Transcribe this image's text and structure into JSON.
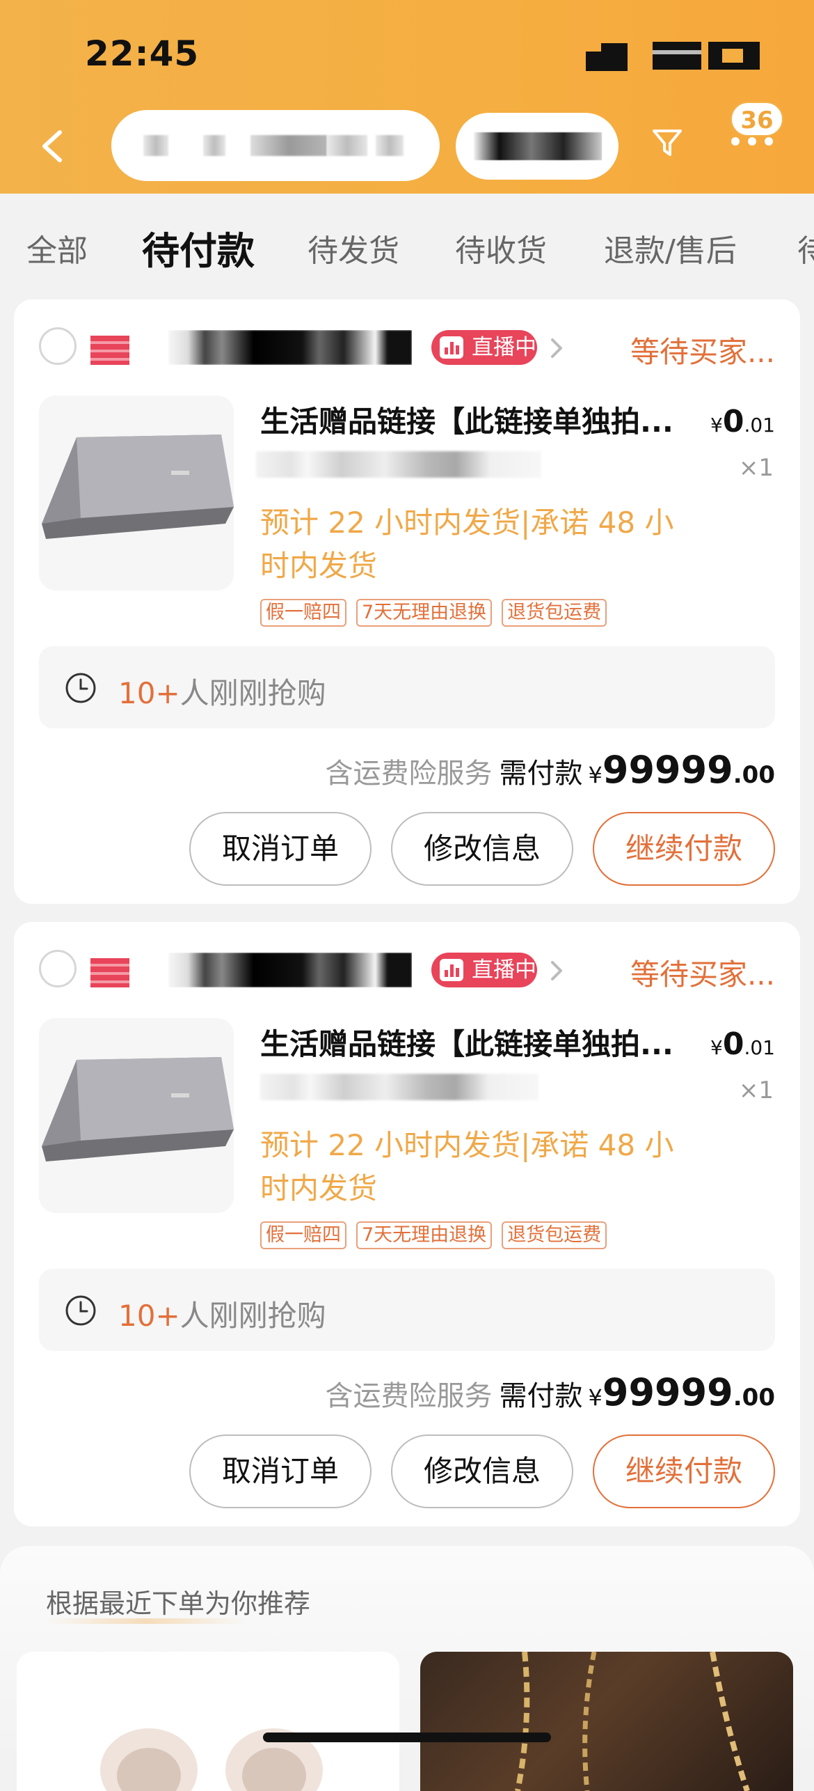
{
  "status_bar": {
    "time": "22:45"
  },
  "header": {
    "message_count": "36",
    "icons": {
      "back": "chevron-left-icon",
      "filter": "funnel-icon",
      "more": "more-dots-icon"
    }
  },
  "tabs": [
    {
      "label": "全部",
      "active": false
    },
    {
      "label": "待付款",
      "active": true
    },
    {
      "label": "待发货",
      "active": false
    },
    {
      "label": "待收货",
      "active": false
    },
    {
      "label": "退款/售后",
      "active": false
    },
    {
      "label": "待",
      "active": false
    }
  ],
  "orders": [
    {
      "live_label": "直播中",
      "status": "等待买家...",
      "product_title": "生活赠品链接【此链接单独拍...",
      "price_currency": "¥",
      "price_int": "0",
      "price_dec": ".01",
      "quantity": "×1",
      "shipping_line1": "预计 22 小时内发货|承诺 48 小",
      "shipping_line2": "时内发货",
      "tags": [
        "假一赔四",
        "7天无理由退换",
        "退货包运费"
      ],
      "rush_count": "10+",
      "rush_text": "人刚刚抢购",
      "service_text": "含运费险服务",
      "need_pay_label": "需付款",
      "total_currency": "¥",
      "total_int": "99999",
      "total_dec": ".00",
      "buttons": {
        "cancel": "取消订单",
        "modify": "修改信息",
        "pay": "继续付款"
      }
    },
    {
      "live_label": "直播中",
      "status": "等待买家...",
      "product_title": "生活赠品链接【此链接单独拍...",
      "price_currency": "¥",
      "price_int": "0",
      "price_dec": ".01",
      "quantity": "×1",
      "shipping_line1": "预计 22 小时内发货|承诺 48 小",
      "shipping_line2": "时内发货",
      "tags": [
        "假一赔四",
        "7天无理由退换",
        "退货包运费"
      ],
      "rush_count": "10+",
      "rush_text": "人刚刚抢购",
      "service_text": "含运费险服务",
      "need_pay_label": "需付款",
      "total_currency": "¥",
      "total_int": "99999",
      "total_dec": ".00",
      "buttons": {
        "cancel": "取消订单",
        "modify": "修改信息",
        "pay": "继续付款"
      }
    }
  ],
  "recommend": {
    "title": "根据最近下单为你推荐"
  },
  "colors": {
    "header_bg": "#f5ae41",
    "accent_orange": "#e2703a",
    "shipping_text": "#f0a848",
    "live_badge": "#e8445a"
  }
}
